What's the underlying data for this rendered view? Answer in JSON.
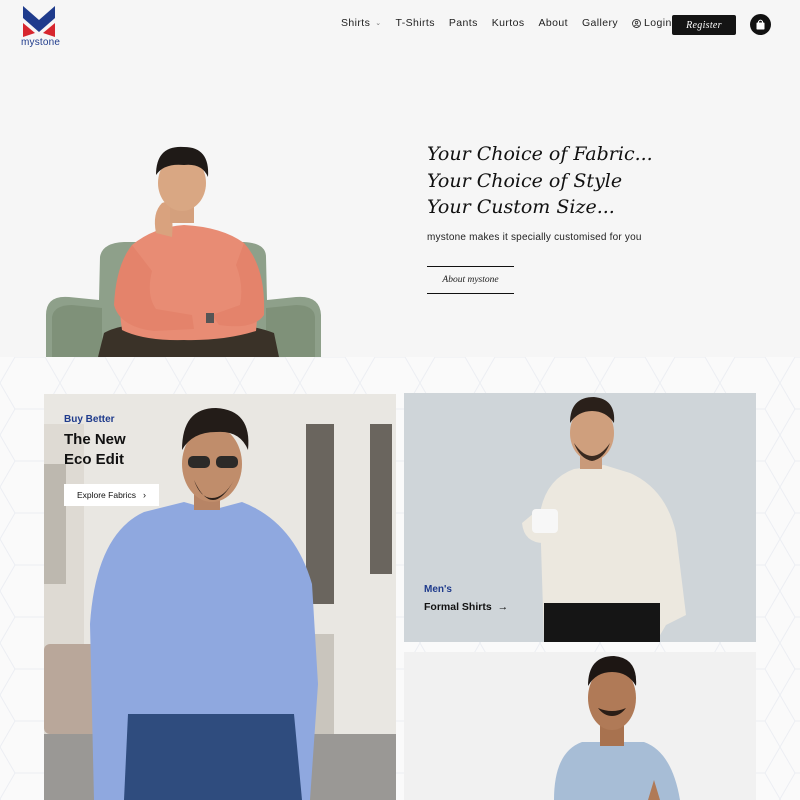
{
  "brand": {
    "name": "mystone",
    "colors": {
      "blue": "#1f3b8c",
      "red": "#d7262e"
    }
  },
  "nav": {
    "items": [
      {
        "label": "Shirts",
        "has_dropdown": true
      },
      {
        "label": "T-Shirts"
      },
      {
        "label": "Pants"
      },
      {
        "label": "Kurtos"
      },
      {
        "label": "About"
      },
      {
        "label": "Gallery"
      }
    ],
    "login_label": "Login",
    "register_label": "Register",
    "cart_icon": "shopping-bag-icon"
  },
  "hero": {
    "lines": [
      "Your Choice of Fabric...",
      "Your Choice of Style",
      "Your Custom Size..."
    ],
    "subtitle": "mystone makes it specially customised for you",
    "button_label": "About mystone"
  },
  "cards": {
    "eco": {
      "kicker": "Buy Better",
      "title_line1": "The New",
      "title_line2": "Eco Edit",
      "button_label": "Explore Fabrics",
      "button_icon": "chevron-right-icon"
    },
    "formal": {
      "kicker": "Men's",
      "link_label": "Formal Shirts",
      "link_icon": "arrow-right-icon"
    }
  }
}
